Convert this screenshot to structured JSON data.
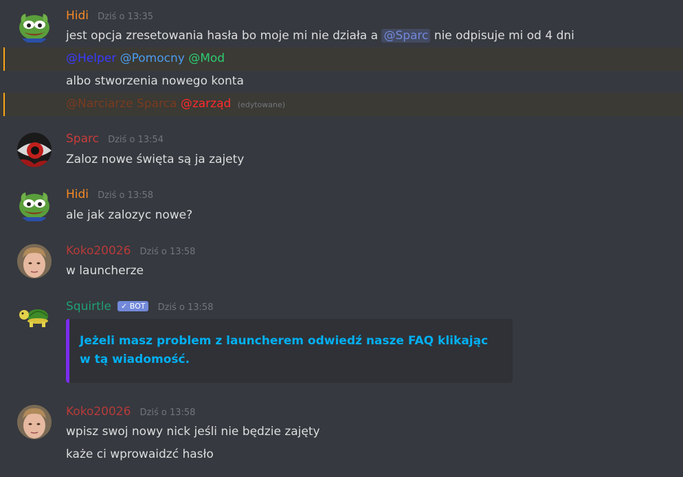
{
  "messages": {
    "hidi1": {
      "username": "Hidi",
      "username_color": "#f58a26",
      "timestamp": "Dziś o 13:35",
      "line1_text_a": "jest opcja zresetowania hasła bo moje mi nie działa a",
      "line1_mention": "@Sparc",
      "line1_text_b": "nie odpisuje mi od 4 dni",
      "line2_mentions": [
        "@Helper",
        "@Pomocny",
        "@Mod"
      ],
      "line3_text": "albo stworzenia nowego konta",
      "line4_mention_a": "@Narciarze Sparca",
      "line4_mention_b": "@zarząd",
      "line4_edited": "(edytowane)"
    },
    "sparc": {
      "username": "Sparc",
      "username_color": "#c83c3c",
      "timestamp": "Dziś o 13:54",
      "text": "Zaloz nowe święta są ja zajety"
    },
    "hidi2": {
      "username": "Hidi",
      "timestamp": "Dziś o 13:58",
      "text": "ale jak zalozyc nowe?"
    },
    "koko1": {
      "username": "Koko20026",
      "username_color": "#b73a3a",
      "timestamp": "Dziś o 13:58",
      "text": "w launcherze"
    },
    "squirtle": {
      "username": "Squirtle",
      "username_color": "#1f9f74",
      "bot_tag": "BOT",
      "bot_check": "✓",
      "timestamp": "Dziś o 13:58",
      "embed_text": "Jeżeli masz problem z launcherem odwiedź nasze FAQ klikając w tą wiadomość."
    },
    "koko2": {
      "username": "Koko20026",
      "timestamp": "Dziś o 13:58",
      "text1": "wpisz swoj nowy nick jeśli nie będzie zajęty",
      "text2": "każe ci wprowaidzć hasło"
    }
  },
  "colors": {
    "background": "#36393f",
    "mention_blue": "#7289da",
    "mention_darkblue": "#3a3aff",
    "mention_lightblue": "#4b9cf0",
    "mention_green": "#2ecc71",
    "mention_brown": "#7a3b1e",
    "mention_red": "#ff2a2a",
    "highlight_bar": "#faa61a",
    "embed_link": "#00b0f4",
    "embed_bar": "#7b2cf0"
  },
  "icons": {
    "hidi_avatar": "pepe-frog-icon",
    "sparc_avatar": "eye-icon",
    "koko_avatar": "boy-face-icon",
    "squirtle_avatar": "turtle-icon"
  }
}
